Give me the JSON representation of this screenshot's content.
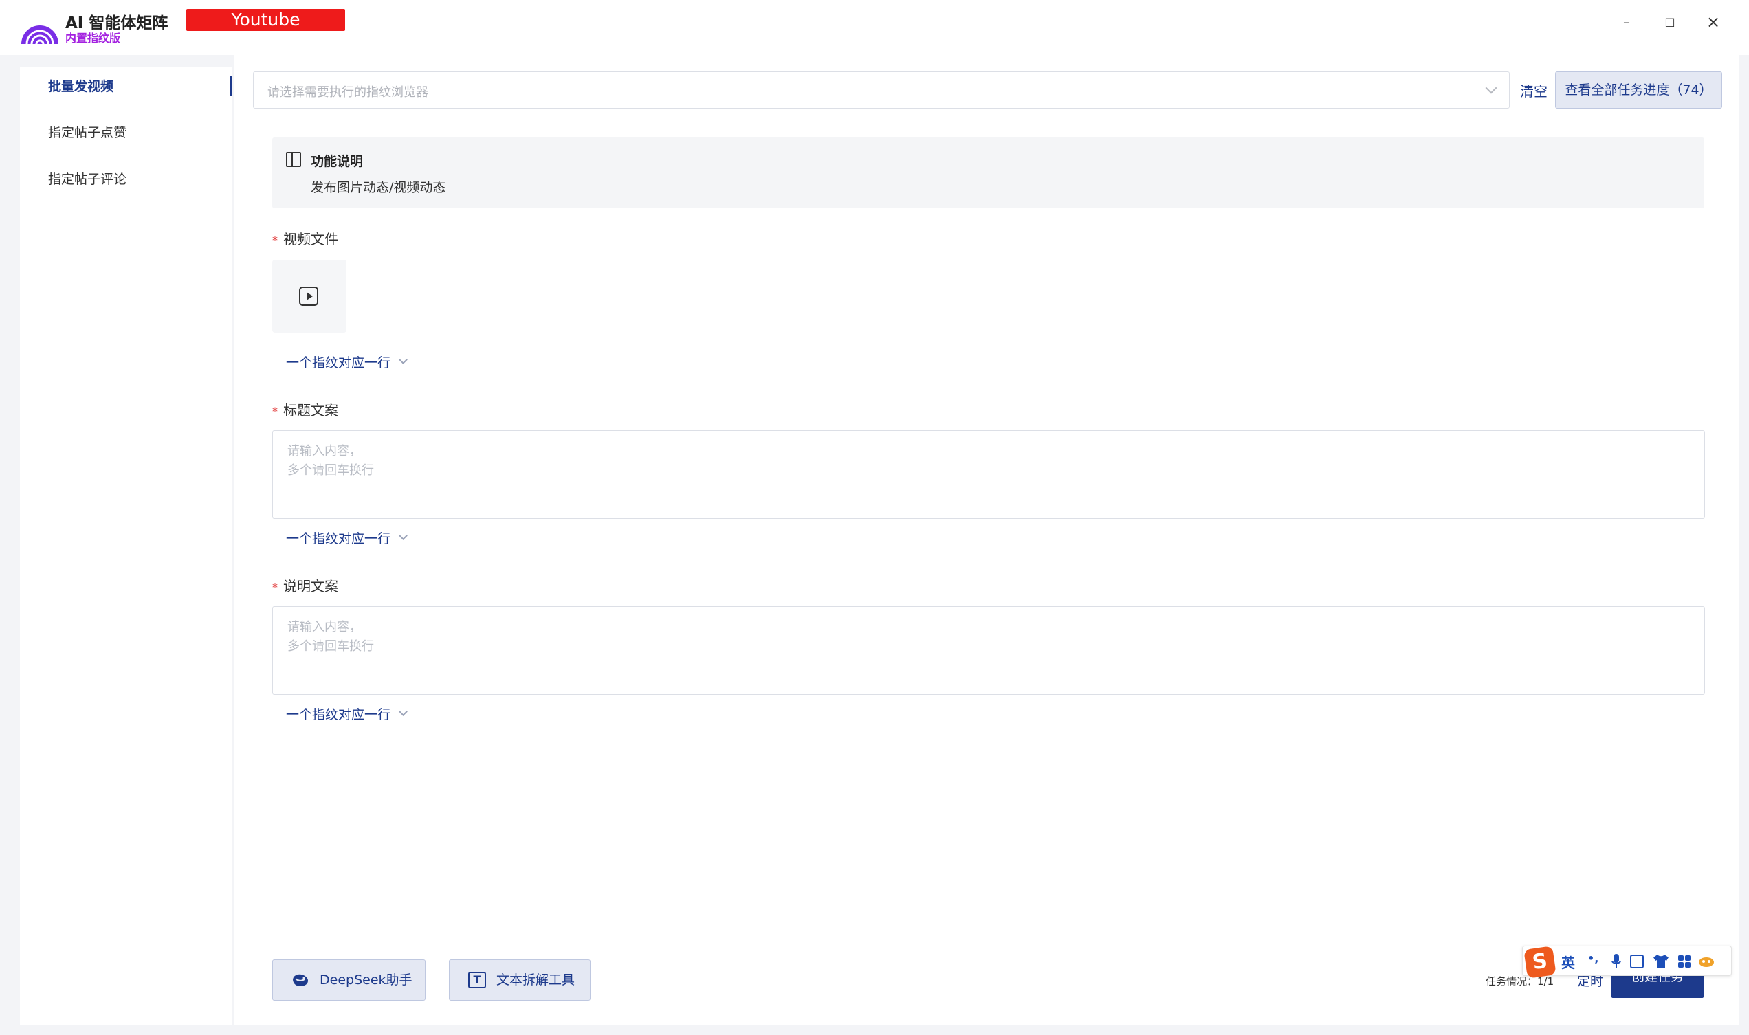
{
  "app": {
    "title": "AI 智能体矩阵",
    "subtitle": "内置指纹版",
    "platform": "Youtube",
    "brand_color": "#a422e0"
  },
  "window": {
    "minimize": "–",
    "maximize": "□",
    "close": "×"
  },
  "sidebar": {
    "items": [
      {
        "label": "批量发视频",
        "active": true
      },
      {
        "label": "指定帖子点赞",
        "active": false
      },
      {
        "label": "指定帖子评论",
        "active": false
      }
    ]
  },
  "toolbar": {
    "browser_placeholder": "请选择需要执行的指纹浏览器",
    "clear_label": "清空",
    "progress_label": "查看全部任务进度（74）"
  },
  "info": {
    "title": "功能说明",
    "text": "发布图片动态/视频动态"
  },
  "form": {
    "video": {
      "label": "视频文件",
      "hint": "一个指纹对应一行"
    },
    "title": {
      "label": "标题文案",
      "placeholder": "请输入内容，\n多个请回车换行",
      "hint": "一个指纹对应一行"
    },
    "desc": {
      "label": "说明文案",
      "placeholder": "请输入内容，\n多个请回车换行",
      "hint": "一个指纹对应一行"
    }
  },
  "footer": {
    "deepseek_label": "DeepSeek助手",
    "split_label": "文本拆解工具",
    "status_text": "任务情况：1/1",
    "timer_label": "定时",
    "create_label": "创建任务",
    "accent_color": "#1d3a8c"
  },
  "ime": {
    "logo": "S",
    "lang": "英",
    "punct": "•,"
  }
}
